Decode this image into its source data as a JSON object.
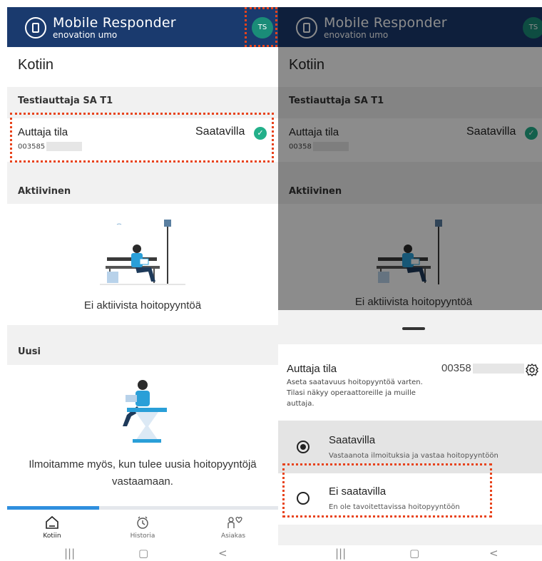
{
  "app": {
    "title": "Mobile Responder",
    "subtitle": "enovation umo",
    "avatar_initials": "TS"
  },
  "home": {
    "page_title": "Kotiin",
    "group_name": "Testiauttaja SA T1",
    "status_label": "Auttaja tila",
    "phone_prefix_left": "003585",
    "phone_prefix_right": "00358",
    "status_value": "Saatavilla",
    "check_icon": "✓",
    "active_heading": "Aktiivinen",
    "active_empty": "Ei aktiivista hoitopyyntöä",
    "new_heading": "Uusi",
    "new_empty": "Ilmoitamme myös, kun tulee uusia hoitopyyntöjä vastaamaan."
  },
  "nav": {
    "items": [
      {
        "label": "Kotiin",
        "icon": "home-icon"
      },
      {
        "label": "Historia",
        "icon": "clock-icon"
      },
      {
        "label": "Asiakas",
        "icon": "client-icon"
      }
    ]
  },
  "system_nav": {
    "recent": "|||",
    "home": "▢",
    "back": "<"
  },
  "sheet": {
    "title": "Auttaja tila",
    "phone_prefix": "00358",
    "description": "Aseta saatavuus hoitopyyntöä varten. Tilasi näkyy operaattoreille ja muille auttaja.",
    "options": [
      {
        "title": "Saatavilla",
        "subtitle": "Vastaanota ilmoituksia ja vastaa hoitopyyntöön",
        "selected": true
      },
      {
        "title": "Ei saatavilla",
        "subtitle": "En ole tavoitettavissa hoitopyyntöön",
        "selected": false
      }
    ]
  },
  "colors": {
    "header": "#1a3a6e",
    "avatar": "#1a8c78",
    "check": "#23b08a",
    "highlight": "#e8431c",
    "progress": "#2f8fde",
    "illustration_blue": "#2a9fd8"
  },
  "progress": {
    "fraction": 0.34
  }
}
